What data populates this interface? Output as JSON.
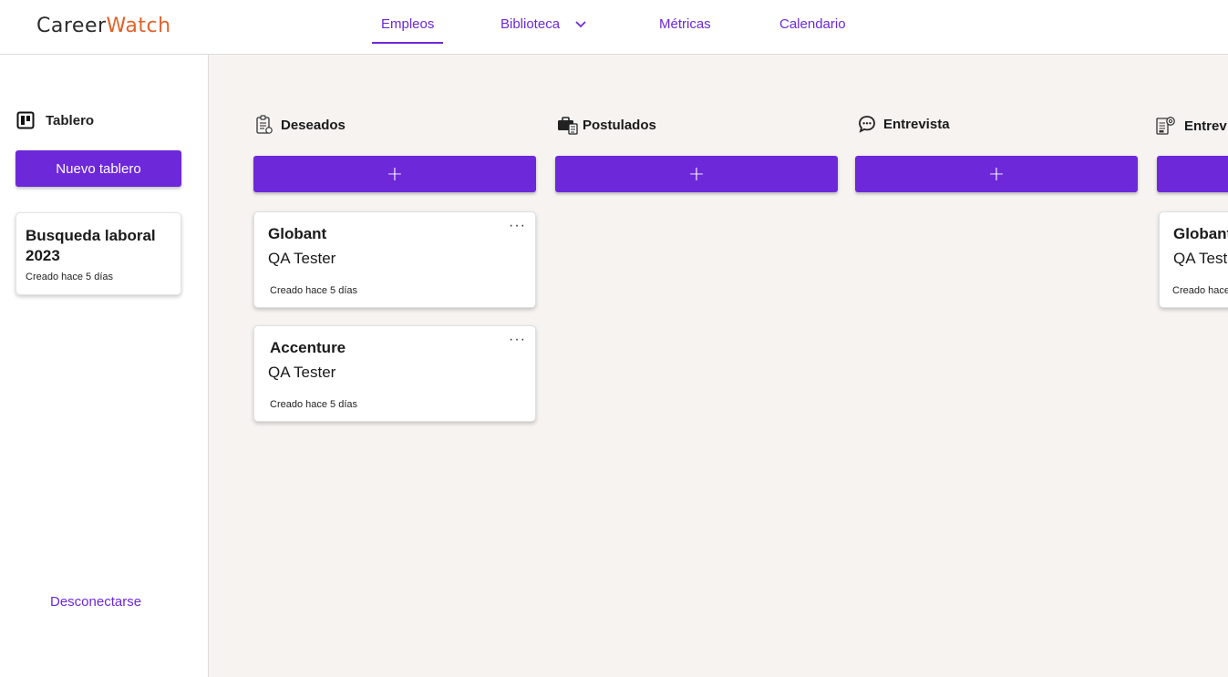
{
  "app": {
    "logo_part1": "Career",
    "logo_part2": "Watch",
    "colors": {
      "accent": "#6d28d9",
      "logo_accent": "#e0622a",
      "board_bg": "#f6f3f1"
    }
  },
  "nav": {
    "items": [
      {
        "label": "Empleos",
        "active": true
      },
      {
        "label": "Biblioteca",
        "icon": "chevron-down-icon"
      },
      {
        "label": "Métricas"
      },
      {
        "label": "Calendario"
      }
    ]
  },
  "sidebar": {
    "title": "Tablero",
    "title_icon": "board-icon",
    "new_board_label": "Nuevo tablero",
    "boards": [
      {
        "name": "Busqueda laboral 2023",
        "created": "Creado hace 5 días"
      }
    ],
    "logout_label": "Desconectarse"
  },
  "columns": [
    {
      "title": "Deseados",
      "icon": "clipboard-list-icon",
      "add_label": "+",
      "cards": [
        {
          "company": "Globant",
          "role": "QA Tester",
          "created": "Creado hace 5 días",
          "menu": "···"
        },
        {
          "company": "Accenture",
          "role": "QA Tester",
          "created": "Creado hace 5 días",
          "menu": "···"
        }
      ]
    },
    {
      "title": "Postulados",
      "icon": "briefcase-document-icon",
      "add_label": "+",
      "cards": []
    },
    {
      "title": "Entrevista",
      "icon": "chat-bubble-icon",
      "add_label": "+",
      "cards": []
    },
    {
      "title": "Entrev",
      "icon": "settings-document-icon",
      "add_label": "+",
      "cards": [
        {
          "company": "Globant",
          "role": "QA Test",
          "created": "Creado hace",
          "menu": ""
        }
      ]
    }
  ]
}
